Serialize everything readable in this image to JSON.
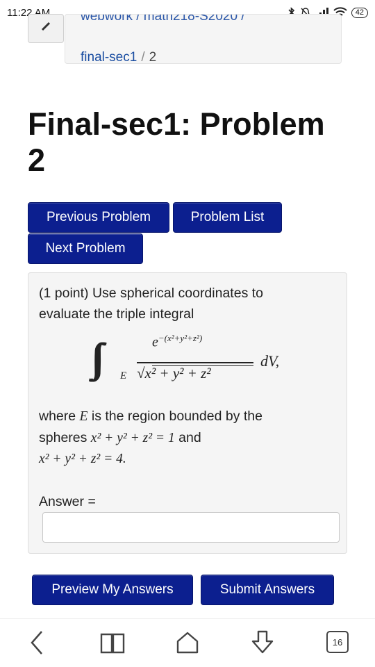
{
  "status": {
    "time": "11:22 AM",
    "battery": "42"
  },
  "breadcrumb": {
    "top_text": "webwork / math218-S2020 /",
    "course_link": "final-sec1",
    "separator": "/",
    "current": "2"
  },
  "page_title": "Final-sec1: Problem 2",
  "nav": {
    "previous_label": "Previous Problem",
    "list_label": "Problem List",
    "next_label": "Next Problem"
  },
  "problem": {
    "intro_line1": "(1 point) Use spherical coordinates to",
    "intro_line2": "evaluate the triple integral",
    "integral": {
      "region": "E",
      "numerator_base": "e",
      "numerator_exponent": "−(x²+y²+z²)",
      "denominator": "√x² + y² + z²",
      "differential": "dV,"
    },
    "where_text_1": "where ",
    "where_var": "E",
    "where_text_2": " is the region bounded by the",
    "spheres_text": "spheres ",
    "sphere1": "x² + y² + z² = 1",
    "and_text": " and",
    "sphere2": "x² + y² + z² = 4.",
    "answer_label": "Answer =",
    "answer_value": ""
  },
  "actions": {
    "preview_label": "Preview My Answers",
    "submit_label": "Submit Answers"
  },
  "browser": {
    "tab_count": "16"
  },
  "colors": {
    "button_bg": "#0c1f8f",
    "link": "#1a4da1",
    "panel_bg": "#f5f5f5"
  }
}
